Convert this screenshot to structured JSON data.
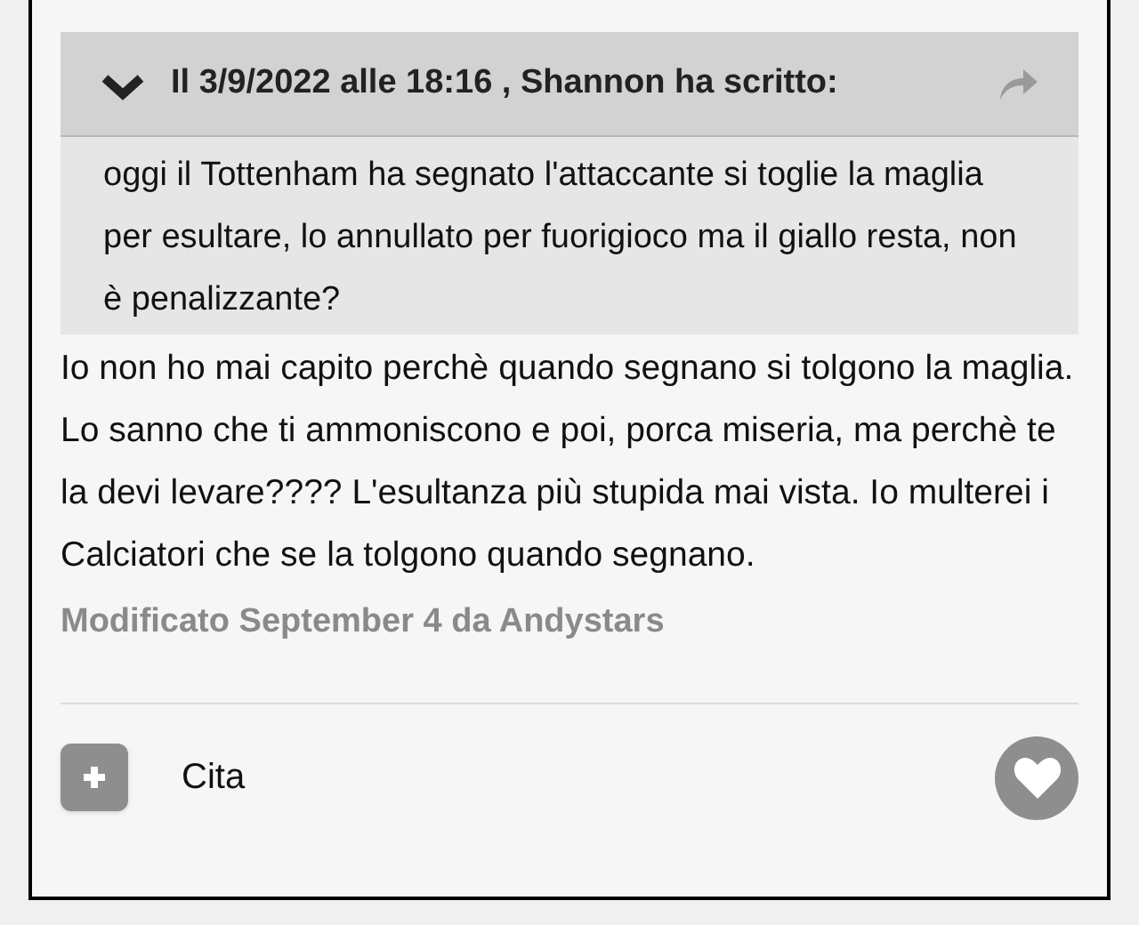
{
  "quote": {
    "expanded": true,
    "header": "Il 3/9/2022 alle 18:16 , Shannon ha scritto:",
    "text": "oggi il Tottenham ha segnato l'attaccante si toglie la maglia per esultare, lo annullato per fuorigioco ma il giallo resta, non è penalizzante?"
  },
  "body": "Io non ho mai capito perchè quando segnano si tolgono la maglia. Lo sanno che ti ammoniscono e poi, porca miseria, ma perchè te la devi levare???? L'esultanza più stupida mai vista. Io multerei i Calciatori che se la tolgono quando segnano.",
  "edited": "Modificato September 4 da Andystars",
  "footer": {
    "quote_label": "Cita",
    "liked": false
  }
}
